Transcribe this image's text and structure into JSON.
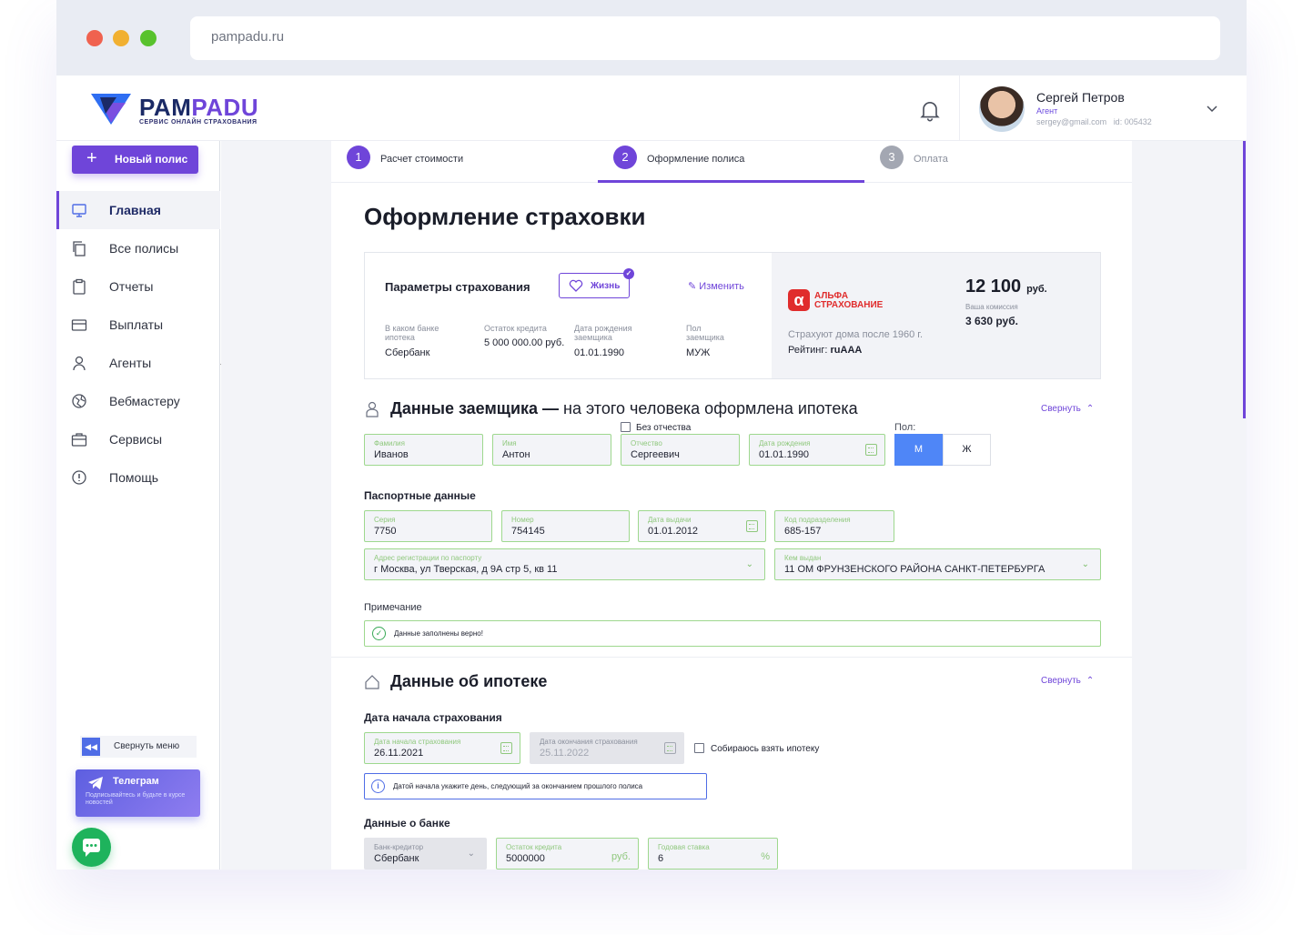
{
  "browser": {
    "url": "pampadu.ru"
  },
  "header": {
    "logo_part1": "PAM",
    "logo_part2": "PADU",
    "logo_sub": "СЕРВИС ОНЛАЙН СТРАХОВАНИЯ",
    "user": {
      "name": "Сергей Петров",
      "role": "Агент",
      "email": "sergey@gmail.com",
      "id": "id: 005432"
    }
  },
  "sidebar": {
    "new_policy": "Новый полис",
    "items": [
      {
        "label": "Главная",
        "icon": "monitor-icon",
        "active": true
      },
      {
        "label": "Все полисы",
        "icon": "copy-icon"
      },
      {
        "label": "Отчеты",
        "icon": "clipboard-icon"
      },
      {
        "label": "Выплаты",
        "icon": "card-icon"
      },
      {
        "label": "Агенты",
        "icon": "user-icon"
      },
      {
        "label": "Вебмастеру",
        "icon": "globe-icon"
      },
      {
        "label": "Сервисы",
        "icon": "briefcase-icon"
      },
      {
        "label": "Помощь",
        "icon": "info-icon"
      }
    ],
    "collapse_menu": "Свернуть меню",
    "telegram": {
      "title": "Телеграм",
      "subtitle": "Подписывайтесь и будьте в курсе новостей"
    }
  },
  "steps": [
    {
      "num": "1",
      "label": "Расчет стоимости"
    },
    {
      "num": "2",
      "label": "Оформление полиса"
    },
    {
      "num": "3",
      "label": "Оплата"
    }
  ],
  "page_title": "Оформление страховки",
  "params": {
    "title": "Параметры страхования",
    "badge": "Жизнь",
    "change": "Изменить",
    "fields": [
      {
        "label": "В каком банке ипотека",
        "value": "Сбербанк"
      },
      {
        "label": "Остаток кредита",
        "value": "5 000 000.00 руб."
      },
      {
        "label": "Дата рождения заемщика",
        "value": "01.01.1990"
      },
      {
        "label": "Пол заемщика",
        "value": "МУЖ"
      }
    ],
    "insurer": {
      "line1": "АЛЬФА",
      "line2": "СТРАХОВАНИЕ",
      "note": "Страхуют дома после 1960 г.",
      "rating_label": "Рейтинг: ",
      "rating_value": "ruAAA"
    },
    "price": {
      "value": "12 100",
      "unit": "руб.",
      "commission_label": "Ваша комиссия",
      "commission_value": "3 630 руб."
    }
  },
  "borrower": {
    "title_bold": "Данные заемщика —",
    "title_light": " на этого человека оформлена ипотека",
    "collapse": "Свернуть",
    "no_patronymic": "Без отчества",
    "sex_label": "Пол:",
    "sex_m": "М",
    "sex_f": "Ж",
    "fields": {
      "last_name": {
        "label": "Фамилия",
        "value": "Иванов"
      },
      "first_name": {
        "label": "Имя",
        "value": "Антон"
      },
      "patronymic": {
        "label": "Отчество",
        "value": "Сергеевич"
      },
      "birth_date": {
        "label": "Дата рождения",
        "value": "01.01.1990"
      }
    },
    "passport_title": "Паспортные данные",
    "passport": {
      "series": {
        "label": "Серия",
        "value": "7750"
      },
      "number": {
        "label": "Номер",
        "value": "754145"
      },
      "issue_date": {
        "label": "Дата выдачи",
        "value": "01.01.2012"
      },
      "dept_code": {
        "label": "Код подразделения",
        "value": "685-157"
      },
      "address": {
        "label": "Адрес регистрации по паспорту",
        "value": "г Москва, ул Тверская, д 9А стр 5, кв 11"
      },
      "issued_by": {
        "label": "Кем выдан",
        "value": "11 ОМ ФРУНЗЕНСКОГО РАЙОНА САНКТ-ПЕТЕРБУРГА"
      }
    },
    "note_title": "Примечание",
    "note_text": "Данные заполнены верно!"
  },
  "mortgage": {
    "title": "Данные об ипотеке",
    "collapse": "Свернуть",
    "start_title": "Дата начала страхования",
    "start": {
      "label": "Дата начала страхования",
      "value": "26.11.2021"
    },
    "end": {
      "label": "Дата окончания страхования",
      "value": "25.11.2022"
    },
    "planning": "Собираюсь взять ипотеку",
    "info": "Датой начала укажите день, следующий за окончанием прошлого полиса",
    "bank_title": "Данные о банке",
    "bank": {
      "label": "Банк-кредитор",
      "value": "Сбербанк"
    },
    "balance": {
      "label": "Остаток кредита",
      "value": "5000000",
      "suffix": "руб."
    },
    "rate": {
      "label": "Годовая ставка",
      "value": "6",
      "suffix": "%"
    }
  }
}
